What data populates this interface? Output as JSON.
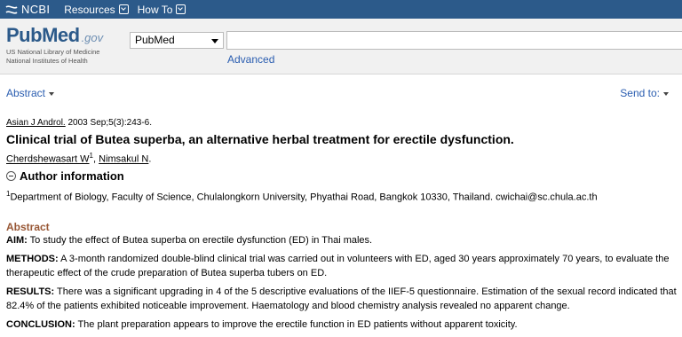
{
  "topbar": {
    "brand": "NCBI",
    "nav": [
      "Resources",
      "How To"
    ]
  },
  "header": {
    "logo_pub": "Pub",
    "logo_med": "Med",
    "logo_gov": ".gov",
    "logo_sub1": "US National Library of Medicine",
    "logo_sub2": "National Institutes of Health",
    "db_select": "PubMed",
    "search_value": "",
    "advanced": "Advanced"
  },
  "display": {
    "format": "Abstract",
    "send_to": "Send to:"
  },
  "article": {
    "journal": "Asian J Androl.",
    "citation_rest": " 2003 Sep;5(3):243-6.",
    "title": "Clinical trial of Butea superba, an alternative herbal treatment for erectile dysfunction.",
    "authors": [
      {
        "name": "Cherdshewasart W",
        "sup": "1"
      },
      {
        "name": "Nimsakul N",
        "sup": ""
      }
    ],
    "author_info_heading": "Author information",
    "affiliation_sup": "1",
    "affiliation": "Department of Biology, Faculty of Science, Chulalongkorn University, Phyathai Road, Bangkok 10330, Thailand. cwichai@sc.chula.ac.th",
    "abstract_heading": "Abstract",
    "sections": [
      {
        "label": "AIM:",
        "text": " To study the effect of Butea superba on erectile dysfunction (ED) in Thai males."
      },
      {
        "label": "METHODS:",
        "text": " A 3-month randomized double-blind clinical trial was carried out in volunteers with ED, aged 30 years approximately 70 years, to evaluate the therapeutic effect of the crude preparation of Butea superba tubers on ED."
      },
      {
        "label": "RESULTS:",
        "text": " There was a significant upgrading in 4 of the 5 descriptive evaluations of the IIEF-5 questionnaire. Estimation of the sexual record indicated that 82.4% of the patients exhibited noticeable improvement. Haematology and blood chemistry analysis revealed no apparent change."
      },
      {
        "label": "CONCLUSION:",
        "text": " The plant preparation appears to improve the erectile function in ED patients without apparent toxicity."
      }
    ]
  }
}
